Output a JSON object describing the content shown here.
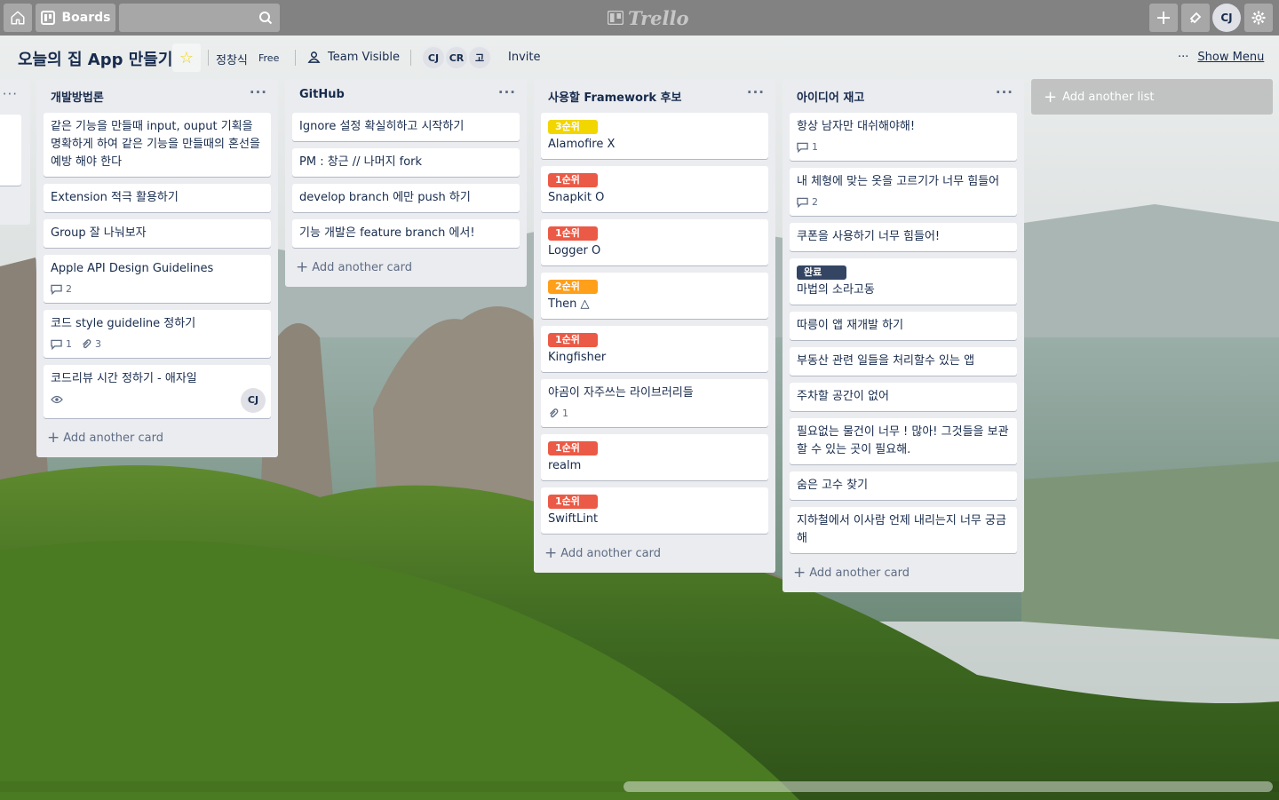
{
  "topbar": {
    "boards_label": "Boards",
    "search_placeholder": "",
    "logo_text": "Trello",
    "user_initials": "CJ"
  },
  "board": {
    "title": "오늘의 집 App 만들기",
    "owner": "정창식",
    "plan": "Free",
    "visibility": "Team Visible",
    "members": [
      "CJ",
      "CR",
      "고"
    ],
    "invite_label": "Invite",
    "show_menu_label": "Show Menu"
  },
  "lists": [
    {
      "title": "개발방법론",
      "cards": [
        {
          "text": "같은 기능을 만들때 input, ouput 기획을 명확하게 하여 같은 기능을 만들때의 혼선을 예방 해야 한다"
        },
        {
          "text": "Extension 적극 활용하기"
        },
        {
          "text": "Group 잘 나눠보자"
        },
        {
          "text": "Apple API Design Guidelines",
          "comments": "2"
        },
        {
          "text": "코드 style guideline 정하기",
          "comments": "1",
          "attachments": "3"
        },
        {
          "text": "코드리뷰 시간 정하기 - 애자일",
          "member": "CJ"
        }
      ],
      "add_card_label": "Add another card"
    },
    {
      "title": "GitHub",
      "cards": [
        {
          "text": "Ignore 설정 확실히하고 시작하기"
        },
        {
          "text": "PM : 창근 // 나머지 fork"
        },
        {
          "text": "develop branch 에만 push 하기"
        },
        {
          "text": "기능 개발은 feature branch 에서!"
        }
      ],
      "add_card_label": "Add another card"
    },
    {
      "title": "사용할 Framework 후보",
      "cards": [
        {
          "label": "3순위",
          "text": "Alamofire X"
        },
        {
          "label": "1순위",
          "text": "Snapkit O"
        },
        {
          "label": "1순위",
          "text": "Logger O"
        },
        {
          "label": "2순위",
          "text": "Then △"
        },
        {
          "label": "1순위",
          "text": "Kingfisher"
        },
        {
          "text": "야곰이 자주쓰는 라이브러리들",
          "attachments": "1"
        },
        {
          "label": "1순위",
          "text": "realm"
        },
        {
          "label": "1순위",
          "text": "SwiftLint"
        }
      ],
      "add_card_label": "Add another card"
    },
    {
      "title": "아이디어 재고",
      "cards": [
        {
          "text": "항상 남자만 대쉬해야해!",
          "comments": "1"
        },
        {
          "text": "내 체형에 맞는 옷을 고르기가 너무 힘들어",
          "comments": "2"
        },
        {
          "text": "쿠폰을 사용하기 너무 힘들어!"
        },
        {
          "label": "완료",
          "text": "마법의 소라고동"
        },
        {
          "text": "따릉이 앱 재개발 하기"
        },
        {
          "text": "부동산 관련 일들을 처리할수 있는 앱"
        },
        {
          "text": "주차할 공간이 없어"
        },
        {
          "text": "필요없는 물건이 너무 ! 많아! 그것들을 보관 할 수 있는 곳이 필요해."
        },
        {
          "text": "숨은 고수 찾기"
        },
        {
          "text": "지하철에서 이사람 언제 내리는지 너무 궁금해"
        }
      ],
      "add_card_label": "Add another card"
    }
  ],
  "add_list_label": "Add another list",
  "label_colors": {
    "1순위": "#eb5a46",
    "2순위": "#ff9f1a",
    "3순위": "#f2d600",
    "완료": "#344563"
  },
  "icons": [
    "home-icon",
    "boards-icon",
    "search-icon",
    "plus-icon",
    "notification-icon",
    "gear-icon",
    "star-icon",
    "team-icon",
    "comment-icon",
    "attachment-icon",
    "watch-icon",
    "more-icon"
  ]
}
